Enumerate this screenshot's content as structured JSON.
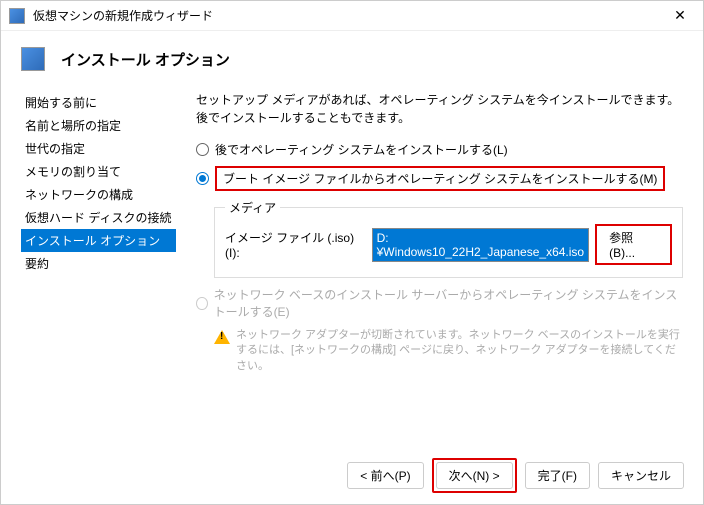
{
  "window": {
    "title": "仮想マシンの新規作成ウィザード",
    "close": "✕"
  },
  "header": {
    "title": "インストール オプション"
  },
  "sidebar": {
    "items": [
      {
        "label": "開始する前に"
      },
      {
        "label": "名前と場所の指定"
      },
      {
        "label": "世代の指定"
      },
      {
        "label": "メモリの割り当て"
      },
      {
        "label": "ネットワークの構成"
      },
      {
        "label": "仮想ハード ディスクの接続"
      },
      {
        "label": "インストール オプション"
      },
      {
        "label": "要約"
      }
    ],
    "selected": 6
  },
  "content": {
    "description": "セットアップ メディアがあれば、オペレーティング システムを今インストールできます。後でインストールすることもできます。",
    "radio_later": "後でオペレーティング システムをインストールする(L)",
    "radio_boot": "ブート イメージ ファイルからオペレーティング システムをインストールする(M)",
    "media_legend": "メディア",
    "iso_label": "イメージ ファイル (.iso)(I):",
    "iso_value": "D:¥Windows10_22H2_Japanese_x64.iso",
    "browse": "参照(B)...",
    "radio_network": "ネットワーク ベースのインストール サーバーからオペレーティング システムをインストールする(E)",
    "warning": "ネットワーク アダプターが切断されています。ネットワーク ベースのインストールを実行するには、[ネットワークの構成] ページに戻り、ネットワーク アダプターを接続してください。"
  },
  "footer": {
    "prev": "< 前へ(P)",
    "next": "次へ(N) >",
    "finish": "完了(F)",
    "cancel": "キャンセル"
  }
}
